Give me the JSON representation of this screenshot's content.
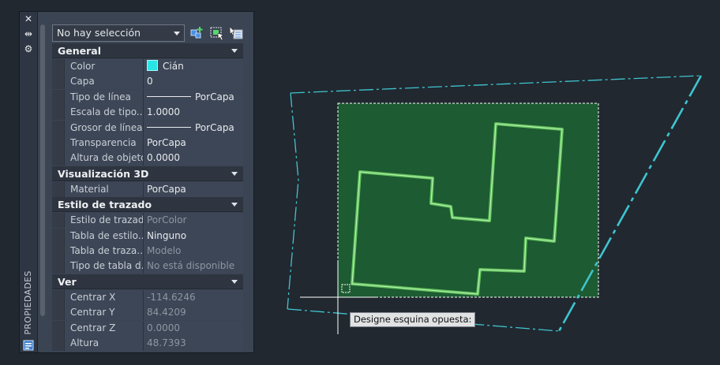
{
  "palette": {
    "title": "PROPIEDADES",
    "close_glyph": "✕",
    "pin_glyph": "⇹",
    "settings_glyph": "⚙",
    "selection": {
      "value": "No hay selección"
    },
    "tools": [
      "quick-select-icon",
      "select-objects-icon",
      "toggle-pickadd-icon"
    ],
    "sections": [
      {
        "title": "General",
        "rows": [
          {
            "name": "Color",
            "value": "Cián"
          },
          {
            "name": "Capa",
            "value": "0"
          },
          {
            "name": "Tipo de línea",
            "value": "PorCapa"
          },
          {
            "name": "Escala de tipo...",
            "value": "1.0000"
          },
          {
            "name": "Grosor de línea",
            "value": "PorCapa"
          },
          {
            "name": "Transparencia",
            "value": "PorCapa"
          },
          {
            "name": "Altura de objeto",
            "value": "0.0000"
          }
        ]
      },
      {
        "title": "Visualización 3D",
        "rows": [
          {
            "name": "Material",
            "value": "PorCapa"
          }
        ]
      },
      {
        "title": "Estilo de trazado",
        "rows": [
          {
            "name": "Estilo de trazado",
            "value": "PorColor"
          },
          {
            "name": "Tabla de estilo...",
            "value": "Ninguno"
          },
          {
            "name": "Tabla de traza...",
            "value": "Modelo"
          },
          {
            "name": "Tipo de tabla d...",
            "value": "No está disponible"
          }
        ]
      },
      {
        "title": "Ver",
        "rows": [
          {
            "name": "Centrar X",
            "value": "-114.6246"
          },
          {
            "name": "Centrar Y",
            "value": "84.4209"
          },
          {
            "name": "Centrar Z",
            "value": "0.0000"
          },
          {
            "name": "Altura",
            "value": "48.7393"
          }
        ]
      }
    ]
  },
  "canvas": {
    "tooltip": "Designe esquina opuesta:",
    "colors": {
      "background": "#212830",
      "boundary": "#3fc4cf",
      "selection_fill": "#1d5b32",
      "polyline": "#8ee68c"
    }
  }
}
